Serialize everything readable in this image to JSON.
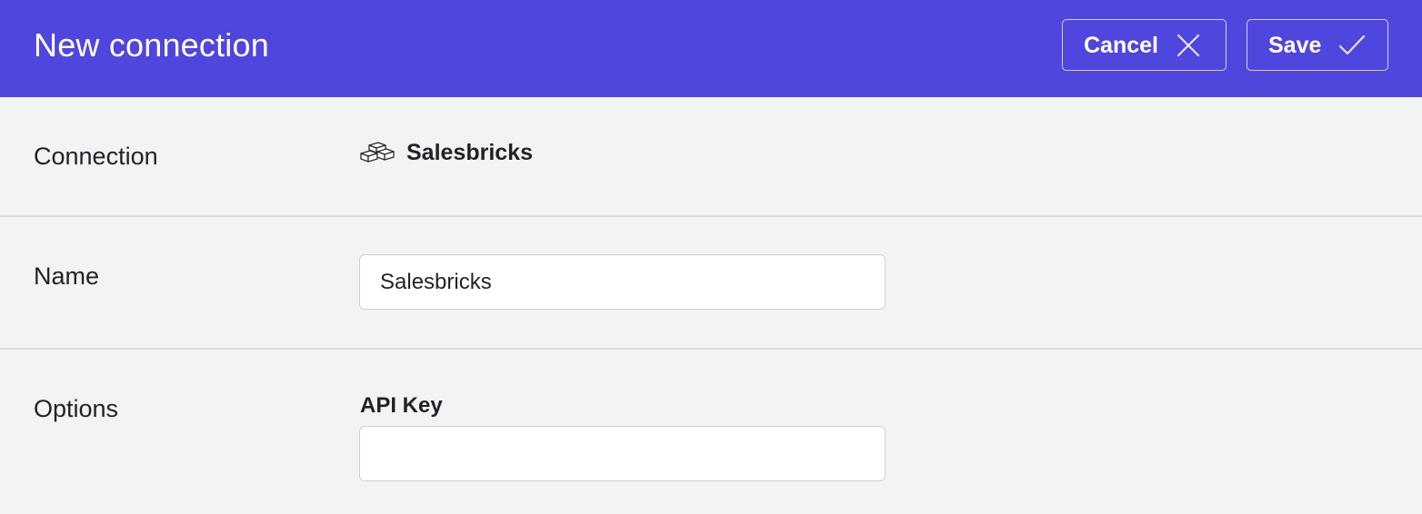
{
  "header": {
    "title": "New connection",
    "cancel_label": "Cancel",
    "save_label": "Save",
    "background_color": "#4f46dd"
  },
  "connection_row": {
    "label": "Connection",
    "value": "Salesbricks",
    "icon": "bricks-icon"
  },
  "name_row": {
    "label": "Name",
    "input_value": "Salesbricks"
  },
  "options_row": {
    "label": "Options",
    "api_key_label": "API Key",
    "api_key_value": ""
  },
  "icons": {
    "cancel": "close-icon",
    "save": "check-icon"
  }
}
